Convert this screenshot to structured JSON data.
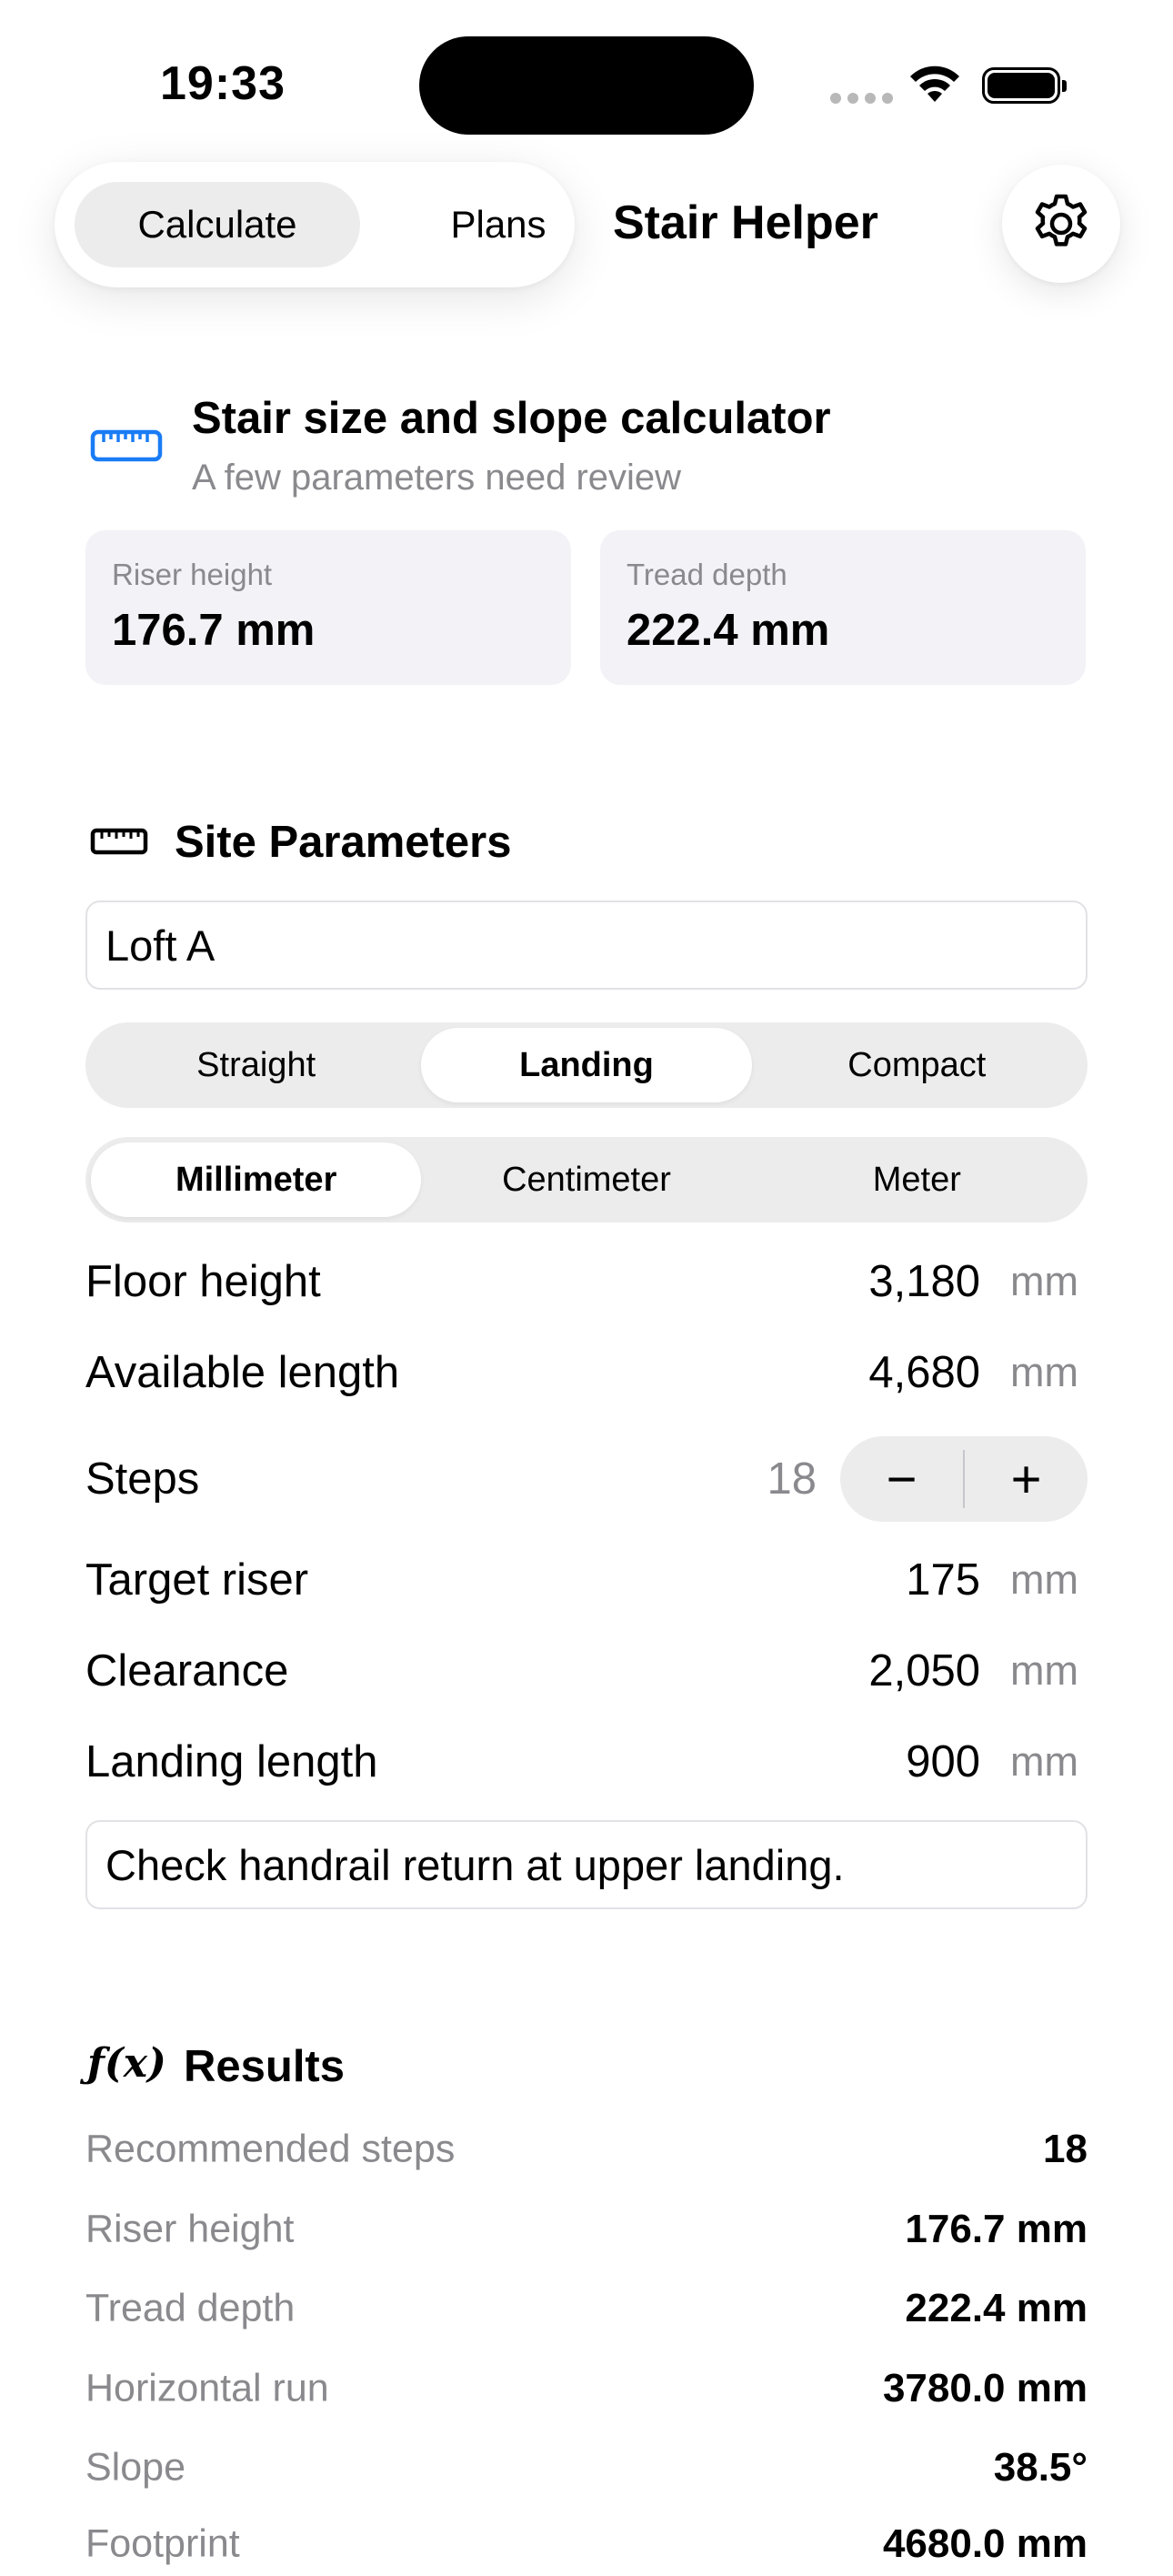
{
  "status_bar": {
    "time": "19:33"
  },
  "header": {
    "tabs": [
      {
        "label": "Calculate",
        "selected": true
      },
      {
        "label": "Plans",
        "selected": false
      }
    ],
    "title": "Stair Helper",
    "settings_icon": "gear-icon"
  },
  "summary": {
    "icon": "ruler-icon",
    "title": "Stair size and slope calculator",
    "subtitle": "A few parameters need review",
    "cards": [
      {
        "label": "Riser height",
        "value": "176.7 mm"
      },
      {
        "label": "Tread depth",
        "value": "222.4 mm"
      }
    ]
  },
  "site": {
    "icon": "tape-measure-icon",
    "heading": "Site Parameters",
    "name_value": "Loft A",
    "stair_types": [
      "Straight",
      "Landing",
      "Compact"
    ],
    "stair_type_selected": "Landing",
    "units": [
      "Millimeter",
      "Centimeter",
      "Meter"
    ],
    "unit_selected": "Millimeter",
    "floor_height": {
      "label": "Floor height",
      "value": "3,180",
      "unit": "mm"
    },
    "available_length": {
      "label": "Available length",
      "value": "4,680",
      "unit": "mm"
    },
    "steps": {
      "label": "Steps",
      "value": "18",
      "minus": "−",
      "plus": "+"
    },
    "target_riser": {
      "label": "Target riser",
      "value": "175",
      "unit": "mm"
    },
    "clearance": {
      "label": "Clearance",
      "value": "2,050",
      "unit": "mm"
    },
    "landing_length": {
      "label": "Landing length",
      "value": "900",
      "unit": "mm"
    },
    "note_value": "Check handrail return at upper landing."
  },
  "results": {
    "icon_text": "ƒ(x)",
    "heading": "Results",
    "rows": [
      {
        "key": "Recommended steps",
        "value": "18"
      },
      {
        "key": "Riser height",
        "value": "176.7 mm"
      },
      {
        "key": "Tread depth",
        "value": "222.4 mm"
      },
      {
        "key": "Horizontal run",
        "value": "3780.0 mm"
      },
      {
        "key": "Slope",
        "value": "38.5°"
      },
      {
        "key": "Footprint",
        "value": "4680.0 mm"
      }
    ]
  },
  "colors": {
    "accent": "#1a7cf5",
    "secondary_text": "#8a8a8e",
    "card_bg": "#f2f2f7"
  }
}
